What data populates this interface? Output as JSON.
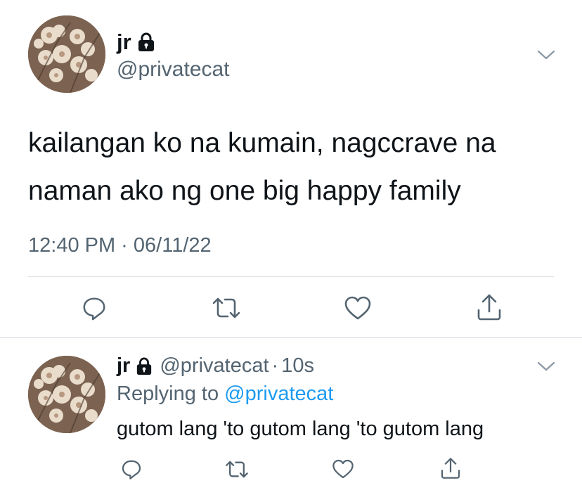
{
  "main_tweet": {
    "display_name": "jr",
    "handle": "@privatecat",
    "text": "kailangan ko na kumain, nagccrave na\nnaman ako ng one big happy family",
    "timestamp": "12:40 PM · 06/11/22"
  },
  "reply_tweet": {
    "display_name": "jr",
    "handle": "@privatecat",
    "separator": "·",
    "time_ago": "10s",
    "replying_prefix": "Replying to ",
    "replying_to": "@privatecat",
    "text": "gutom lang 'to gutom lang 'to gutom lang"
  },
  "icons": {
    "protected": "lock-icon",
    "menu": "chevron-down-icon",
    "reply": "reply-icon",
    "retweet": "retweet-icon",
    "like": "heart-icon",
    "share": "share-icon"
  },
  "colors": {
    "text": "#0f1419",
    "secondary": "#536471",
    "link": "#1d9bf0",
    "divider": "#d9dee2"
  }
}
